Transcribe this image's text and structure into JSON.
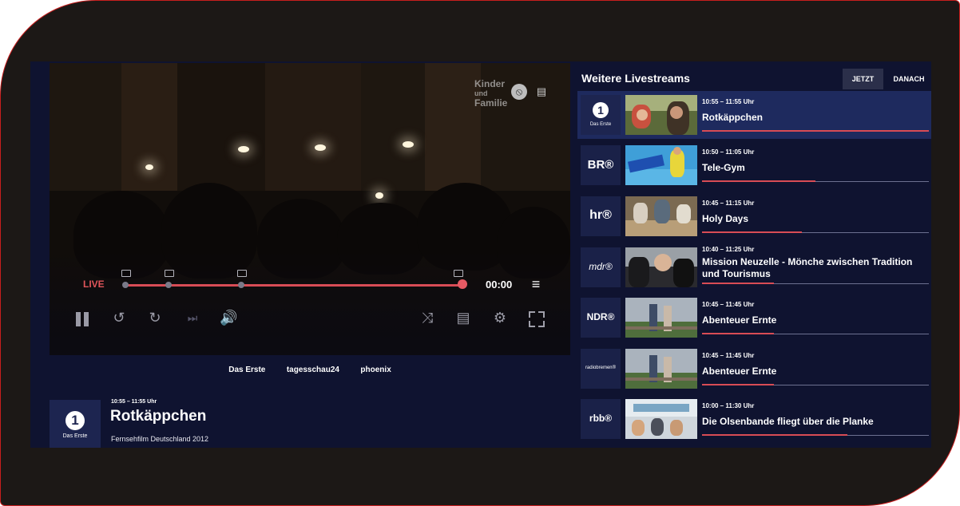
{
  "player": {
    "watermark_line1": "Kinder",
    "watermark_line2": "und",
    "watermark_line3": "Familie",
    "live_label": "LIVE",
    "time": "00:00",
    "progress": 1.0
  },
  "channel_tabs": [
    "Das Erste",
    "tagesschau24",
    "phoenix"
  ],
  "program": {
    "logo_glyph": "1",
    "logo_caption": "Das Erste",
    "time": "10:55 – 11:55 Uhr",
    "title": "Rotkäppchen",
    "description": "Fernsehfilm Deutschland 2012"
  },
  "sidebar": {
    "title": "Weitere Livestreams",
    "tabs": [
      "JETZT",
      "DANACH"
    ],
    "items": [
      {
        "channel": "Das Erste",
        "logo_text": "1",
        "logo_caption": "Das Erste",
        "time": "10:55 – 11:55 Uhr",
        "title": "Rotkäppchen",
        "progress": 1.0,
        "active": true
      },
      {
        "channel": "BR",
        "logo_text": "BR®",
        "time": "10:50 – 11:05 Uhr",
        "title": "Tele-Gym",
        "progress": 0.5
      },
      {
        "channel": "hr",
        "logo_text": "hr®",
        "time": "10:45 – 11:15 Uhr",
        "title": "Holy Days",
        "progress": 0.44
      },
      {
        "channel": "mdr",
        "logo_text": "mdr®",
        "time": "10:40 – 11:25 Uhr",
        "title": "Mission Neuzelle - Mönche zwischen Tradition und Tourismus",
        "progress": 0.32
      },
      {
        "channel": "NDR",
        "logo_text": "NDR®",
        "time": "10:45 – 11:45 Uhr",
        "title": "Abenteuer Ernte",
        "progress": 0.32
      },
      {
        "channel": "radio bremen",
        "logo_text": "radiobremen®",
        "time": "10:45 – 11:45 Uhr",
        "title": "Abenteuer Ernte",
        "progress": 0.32
      },
      {
        "channel": "rbb",
        "logo_text": "rbb®",
        "time": "10:00 – 11:30 Uhr",
        "title": "Die Olsenbande fliegt über die Planke",
        "progress": 0.64
      }
    ]
  },
  "colors": {
    "accent": "#d84c55",
    "app_bg": "#0f1330",
    "active_row": "#1e2a5e"
  }
}
